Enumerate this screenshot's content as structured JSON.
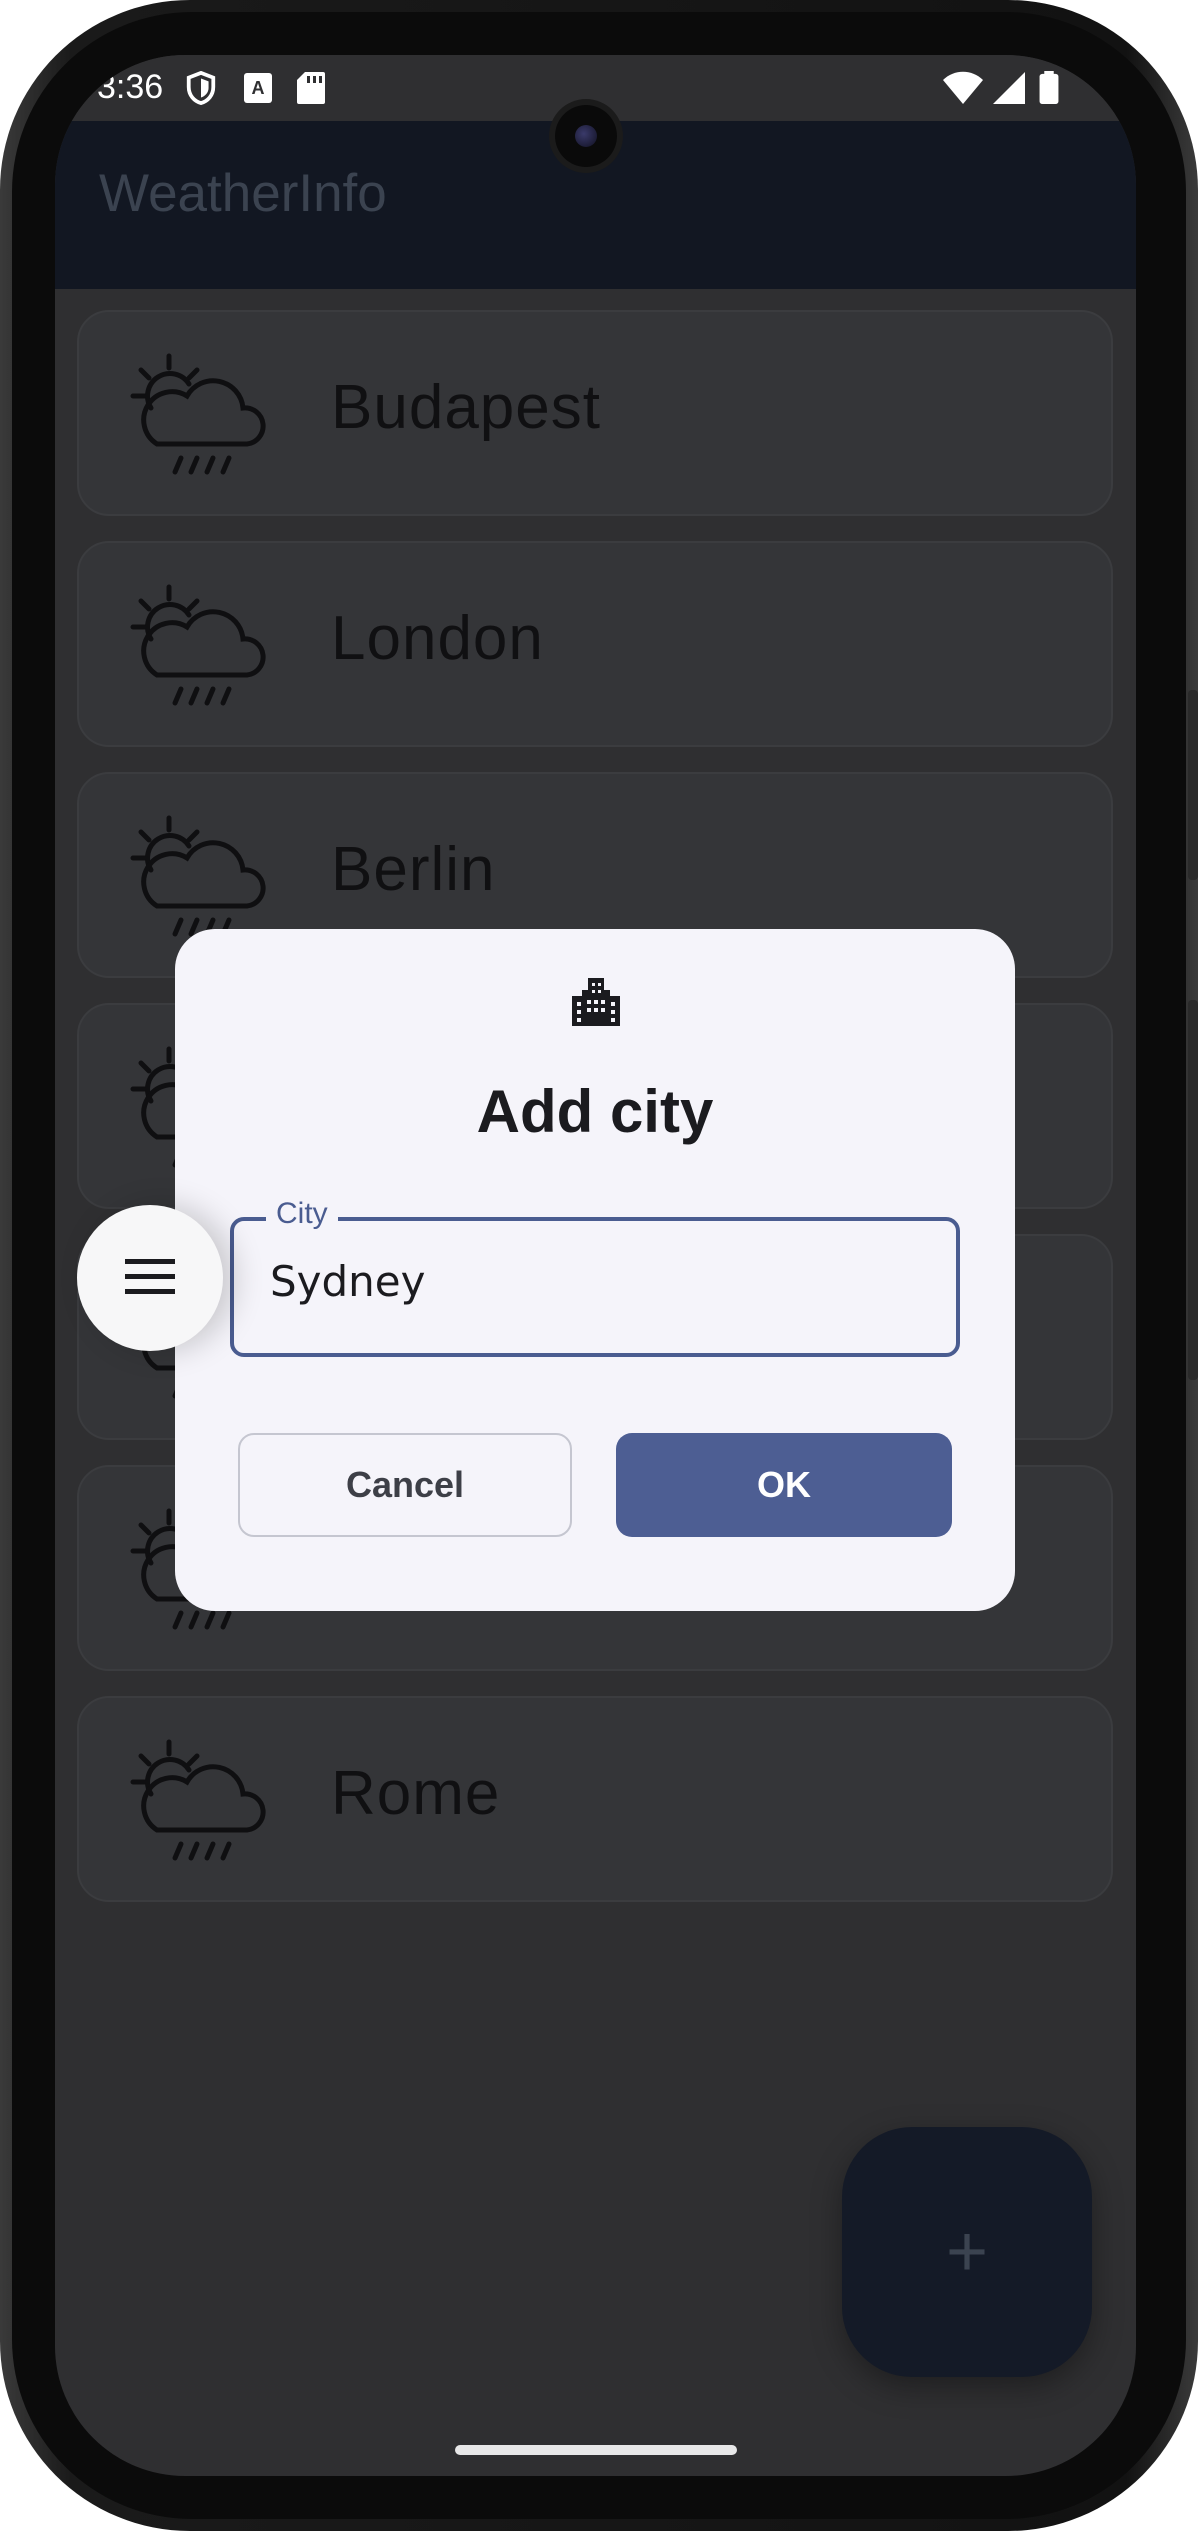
{
  "statusbar": {
    "time": "3:36"
  },
  "appbar": {
    "title": "WeatherInfo"
  },
  "cities": [
    {
      "name": "Budapest",
      "icon": "partly-cloudy-rain-icon"
    },
    {
      "name": "London",
      "icon": "partly-cloudy-rain-icon"
    },
    {
      "name": "Berlin",
      "icon": "partly-cloudy-rain-icon"
    },
    {
      "name": "",
      "icon": "partly-cloudy-rain-icon"
    },
    {
      "name": "",
      "icon": "partly-cloudy-rain-icon"
    },
    {
      "name": "",
      "icon": "partly-cloudy-rain-icon"
    },
    {
      "name": "Rome",
      "icon": "partly-cloudy-rain-icon"
    }
  ],
  "fab": {
    "label": "+"
  },
  "dialog": {
    "icon": "city-building-icon",
    "title": "Add city",
    "field_label": "City",
    "field_value": "Sydney",
    "cancel_label": "Cancel",
    "ok_label": "OK"
  },
  "colors": {
    "scrim_background": "#2f2f31",
    "appbar": "#121722",
    "dialog_surface": "#f5f4fa",
    "primary": "#4d5e93"
  }
}
